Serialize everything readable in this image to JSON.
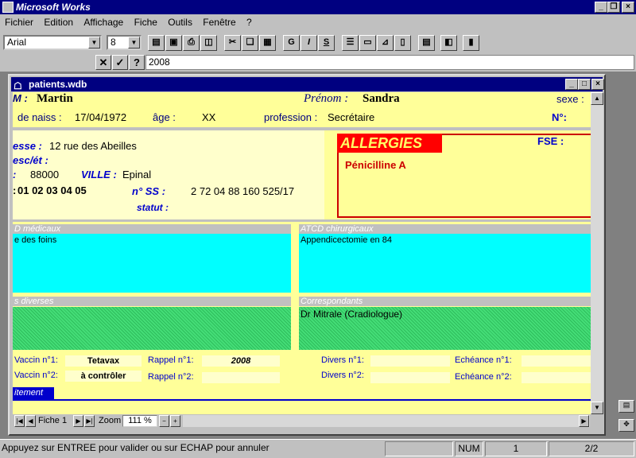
{
  "app": {
    "title": "Microsoft Works"
  },
  "menu": [
    "Fichier",
    "Edition",
    "Affichage",
    "Fiche",
    "Outils",
    "Fenêtre",
    "?"
  ],
  "toolbar": {
    "font": "Arial",
    "size": "8",
    "bold": "G",
    "italic": "I",
    "underline": "S"
  },
  "formula": {
    "cancel": "✕",
    "confirm": "✓",
    "help": "?",
    "value": "2008"
  },
  "doc": {
    "title": "patients.wdb"
  },
  "form": {
    "nom_label": "M :",
    "nom": "Martin",
    "prenom_label": "Prénom :",
    "prenom": "Sandra",
    "sexe_label": "sexe :",
    "naiss_label": "de naiss :",
    "naiss": "17/04/1972",
    "age_label": "âge :",
    "age": "XX",
    "profession_label": "profession :",
    "profession": "Secrétaire",
    "no_label": "N°:",
    "adresse_label": "esse :",
    "adresse": "12 rue des Abeilles",
    "escet_label": "esc/ét :",
    "cp_label": ":",
    "cp": "88000",
    "ville_label": "VILLE :",
    "ville": "Epinal",
    "tel_label": ":",
    "tel": "01 02 03 04 05",
    "ss_label": "n° SS :",
    "ss": "2 72 04 88 160 525/17",
    "statut_label": "statut :",
    "fse_label": "FSE :",
    "allergies_title": "ALLERGIES",
    "allergies": "Pénicilline A",
    "atcd_med_label": "D médicaux",
    "atcd_med": "e des foins",
    "atcd_chir_label": "ATCD chirurgicaux",
    "atcd_chir": "Appendicectomie en 84",
    "diverses_label": "s diverses",
    "correspondants_label": "Correspondants",
    "correspondants": "Dr Mitrale (Cradiologue)",
    "vaccin1_label": "Vaccin n°1:",
    "vaccin1": "Tetavax",
    "vaccin2_label": "Vaccin n°2:",
    "vaccin2": "à contrôler",
    "rappel1_label": "Rappel n°1:",
    "rappel1": "2008",
    "rappel2_label": "Rappel n°2:",
    "divers1_label": "Divers n°1:",
    "divers2_label": "Divers n°2:",
    "echeance1_label": "Echéance n°1:",
    "echeance2_label": "Echéance n°2:",
    "traitement_label": "itement"
  },
  "nav": {
    "fiche": "Fiche 1",
    "zoom_label": "Zoom",
    "zoom": "111 %"
  },
  "status": {
    "message": "Appuyez sur ENTREE pour valider ou sur ECHAP pour annuler",
    "num": "NUM",
    "record": "1",
    "count": "2/2"
  }
}
